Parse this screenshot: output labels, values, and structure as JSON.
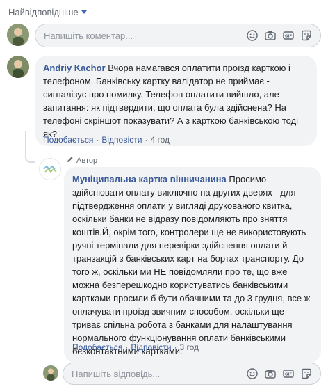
{
  "sort": {
    "label": "Найвідповідніше"
  },
  "composer": {
    "placeholder": "Напишіть коментар..."
  },
  "comment1": {
    "author": "Andriy Kachor",
    "text": "Вчора намагався оплатити проїзд карткою і телефоном. Банківську картку валідатор не приймає - сигналізує про помилку. Телефон оплатити вийшло, але запитання: як підтвердити, що оплата була здійснена? На телефоні скріншот показувати? А з карткою банківською тоді як?",
    "like": "Подобається",
    "reply": "Відповісти",
    "time": "4 год"
  },
  "reply1": {
    "badge": "Автор",
    "author": "Муніципальна картка вінничанина",
    "text": "Просимо здійснювати оплату виключно на других дверях - для підтвердження оплати у вигляді друкованого квитка, оскільки банки не відразу повідомляють про зняття коштів.Й, окрім того, контролери ще не використовують ручні термінали для перевірки здійснення оплати й транзакцій з банківських карт на бортах транспорту. До того ж, оскільки ми НЕ повідомляли про те, що вже можна безперешкодно користуватись банківськими картками просили б бути обачними та до 3 грудня, все ж оплачувати проїзд звичним способом, оскільки ще триває спільна робота з банками для налаштування нормального функціонування оплати банківськими безконтактними картками.",
    "like": "Подобається",
    "reply": "Відповісти",
    "time": "3 год"
  },
  "reply_composer": {
    "placeholder": "Напишіть відповідь..."
  },
  "colors": {
    "link": "#385898",
    "bubble": "#f2f3f5",
    "muted": "#606770"
  },
  "icons": [
    "emoji-icon",
    "camera-icon",
    "gif-icon",
    "sticker-icon"
  ]
}
